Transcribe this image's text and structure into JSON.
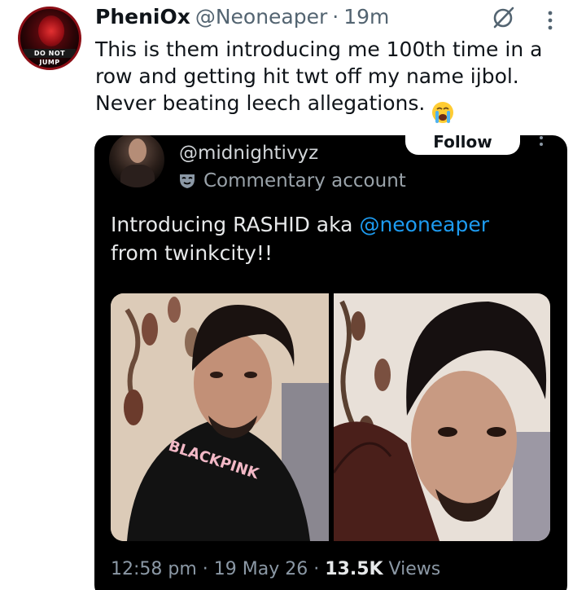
{
  "author": {
    "display_name": "PheniOx",
    "handle": "@Neoneaper",
    "separator": "·",
    "time_ago": "19m",
    "avatar_text": "DO NOT JUMP"
  },
  "tweet": {
    "text": "This is them introducing me 100th time in a\nrow and getting hit twt off my name ijbol.\nNever beating leech allegations.",
    "emoji": "loudly-crying-face-emoji"
  },
  "quoted": {
    "handle": "@midnightivyz",
    "label": "Commentary account",
    "follow_label": "Follow",
    "text_before": "Introducing RASHID aka ",
    "mention": "@neoneaper",
    "text_after": "\nfrom twinkcity!!",
    "photos": [
      {
        "name": "photo-blackpink-shirt",
        "shirt_text": "BLACKPINK"
      },
      {
        "name": "photo-maroon-shirt"
      }
    ],
    "timestamp": "12:58 pm · 19 May 26 · ",
    "views_count": "13.5K",
    "views_label": " Views"
  },
  "colors": {
    "link": "#1d9bf0",
    "text_dark": "#0f1419",
    "muted": "#536471",
    "embed_bg": "#000000"
  }
}
